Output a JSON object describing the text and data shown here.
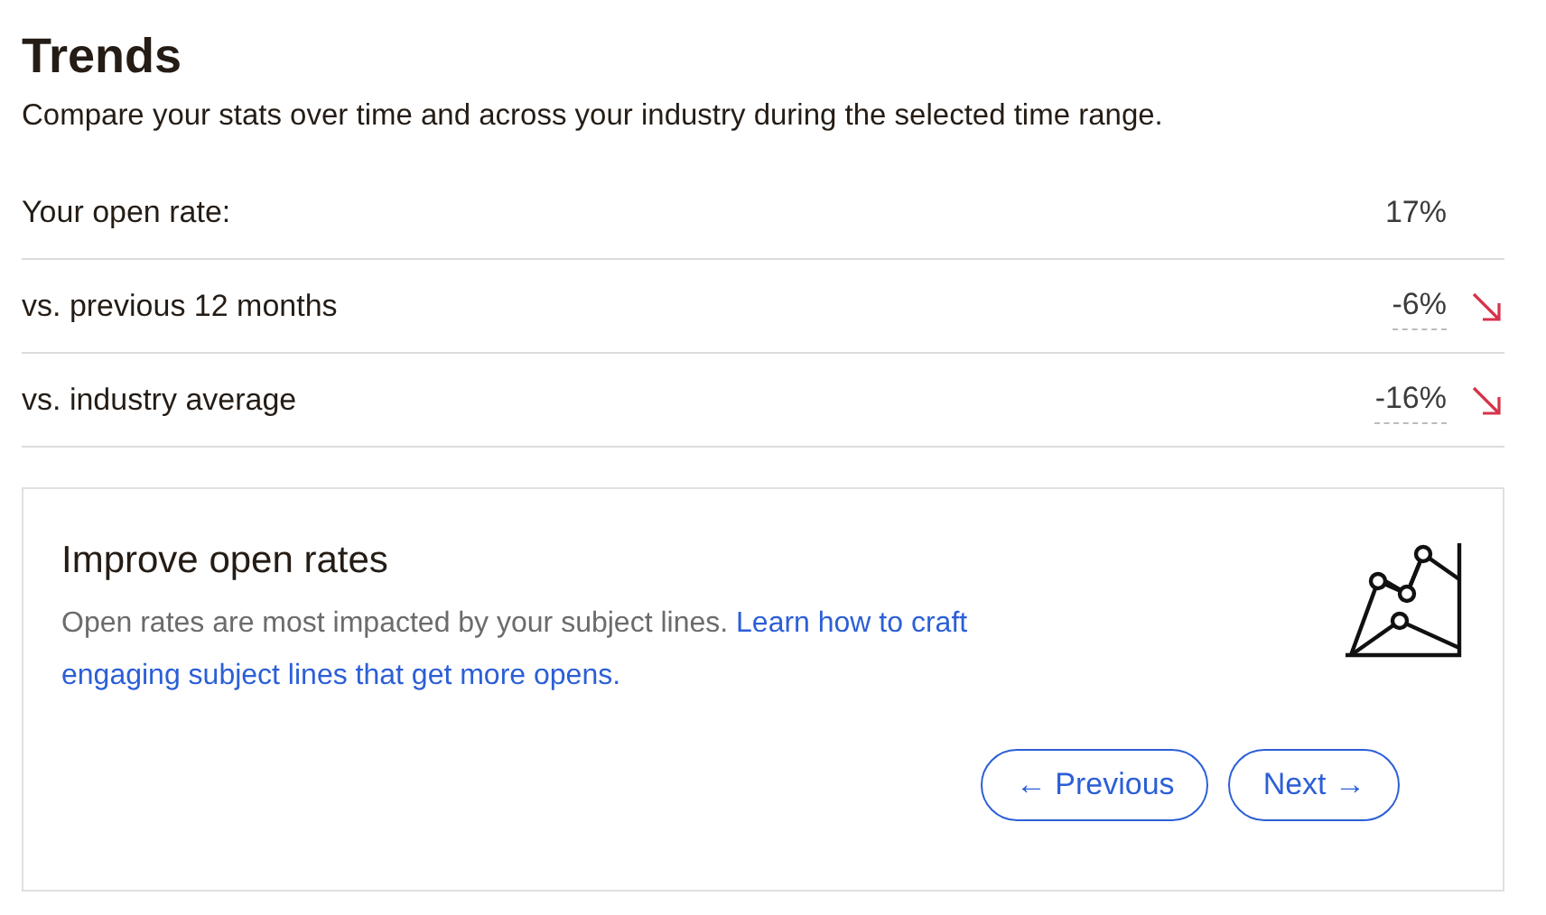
{
  "title": "Trends",
  "subtitle": "Compare your stats over time and across your industry during the selected time range.",
  "stats": [
    {
      "label": "Your open rate:",
      "value": "17%",
      "declining": false
    },
    {
      "label": "vs. previous 12 months",
      "value": "-6%",
      "declining": true
    },
    {
      "label": "vs. industry average",
      "value": "-16%",
      "declining": true
    }
  ],
  "tip": {
    "title": "Improve open rates",
    "text": "Open rates are most impacted by your subject lines.",
    "link_lines": [
      "Learn how to craft",
      "engaging subject lines that get more opens."
    ]
  },
  "buttons": [
    {
      "label": "← Previous"
    },
    {
      "label": "Next →"
    }
  ]
}
